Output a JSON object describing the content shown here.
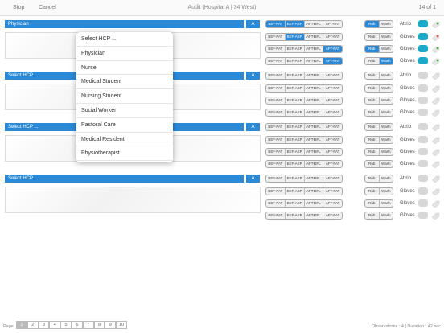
{
  "topbar": {
    "stop": "Stop",
    "cancel": "Cancel",
    "title": "Audit (Hospital A | 34 West)",
    "counter": "14 of 1"
  },
  "seg_labels": [
    "BEF-PAT",
    "BEF-ASP",
    "AFT-BFL",
    "AFT-PAT"
  ],
  "rw_labels": [
    "Rub",
    "Wash"
  ],
  "groups": [
    {
      "hcp": "Physician",
      "a": "A"
    },
    {
      "hcp": "Select HCP ...",
      "a": "A"
    },
    {
      "hcp": "Select HCP ...",
      "a": "A"
    },
    {
      "hcp": "Select HCP ...",
      "a": "A"
    }
  ],
  "rows": [
    {
      "seg": [
        1,
        1,
        0,
        0
      ],
      "rw": [
        1,
        0
      ],
      "label": "Attrib",
      "bubble": true,
      "tag": "green"
    },
    {
      "seg": [
        0,
        1,
        0,
        0
      ],
      "rw": [
        0,
        0
      ],
      "label": "Gloves",
      "bubble": true,
      "tag": "red"
    },
    {
      "seg": [
        0,
        0,
        0,
        1
      ],
      "rw": [
        1,
        0
      ],
      "label": "Gloves",
      "bubble": true,
      "tag": "green"
    },
    {
      "seg": [
        0,
        0,
        0,
        1
      ],
      "rw": [
        0,
        1
      ],
      "label": "Gloves",
      "bubble": true,
      "tag": "green"
    },
    {
      "seg": [
        0,
        0,
        0,
        0
      ],
      "rw": [
        0,
        0
      ],
      "label": "Attrib",
      "bubble": false,
      "tag": "grey"
    },
    {
      "seg": [
        0,
        0,
        0,
        0
      ],
      "rw": [
        0,
        0
      ],
      "label": "Gloves",
      "bubble": false,
      "tag": "grey"
    },
    {
      "seg": [
        0,
        0,
        0,
        0
      ],
      "rw": [
        0,
        0
      ],
      "label": "Gloves",
      "bubble": false,
      "tag": "grey"
    },
    {
      "seg": [
        0,
        0,
        0,
        0
      ],
      "rw": [
        0,
        0
      ],
      "label": "Gloves",
      "bubble": false,
      "tag": "grey"
    },
    {
      "seg": [
        0,
        0,
        0,
        0
      ],
      "rw": [
        0,
        0
      ],
      "label": "Attrib",
      "bubble": false,
      "tag": "grey"
    },
    {
      "seg": [
        0,
        0,
        0,
        0
      ],
      "rw": [
        0,
        0
      ],
      "label": "Gloves",
      "bubble": false,
      "tag": "grey"
    },
    {
      "seg": [
        0,
        0,
        0,
        0
      ],
      "rw": [
        0,
        0
      ],
      "label": "Gloves",
      "bubble": false,
      "tag": "grey"
    },
    {
      "seg": [
        0,
        0,
        0,
        0
      ],
      "rw": [
        0,
        0
      ],
      "label": "Gloves",
      "bubble": false,
      "tag": "grey"
    },
    {
      "seg": [
        0,
        0,
        0,
        0
      ],
      "rw": [
        0,
        0
      ],
      "label": "Attrib",
      "bubble": false,
      "tag": "grey"
    },
    {
      "seg": [
        0,
        0,
        0,
        0
      ],
      "rw": [
        0,
        0
      ],
      "label": "Gloves",
      "bubble": false,
      "tag": "grey"
    },
    {
      "seg": [
        0,
        0,
        0,
        0
      ],
      "rw": [
        0,
        0
      ],
      "label": "Gloves",
      "bubble": false,
      "tag": "grey"
    },
    {
      "seg": [
        0,
        0,
        0,
        0
      ],
      "rw": [
        0,
        0
      ],
      "label": "Gloves",
      "bubble": false,
      "tag": "grey"
    }
  ],
  "dropdown": [
    "Select HCP ...",
    "Physician",
    "Nurse",
    "Medical Student",
    "Nursing Student",
    "Social Worker",
    "Pastoral Care",
    "Medical Resident",
    "Physiotherapist"
  ],
  "footer": {
    "page_label": "Page",
    "pages": [
      "1",
      "2",
      "3",
      "4",
      "5",
      "6",
      "7",
      "8",
      "9",
      "10"
    ],
    "active_page": "1",
    "status": "Observations : 4 | Duration : 42 sec"
  },
  "colors": {
    "accent": "#2b8ad8",
    "bubble": "#1aa9c8",
    "tag_green": "#3da53d",
    "tag_red": "#d9534f"
  },
  "icons": {
    "bubble": "comment-bubble-icon",
    "tag": "tag-icon"
  }
}
